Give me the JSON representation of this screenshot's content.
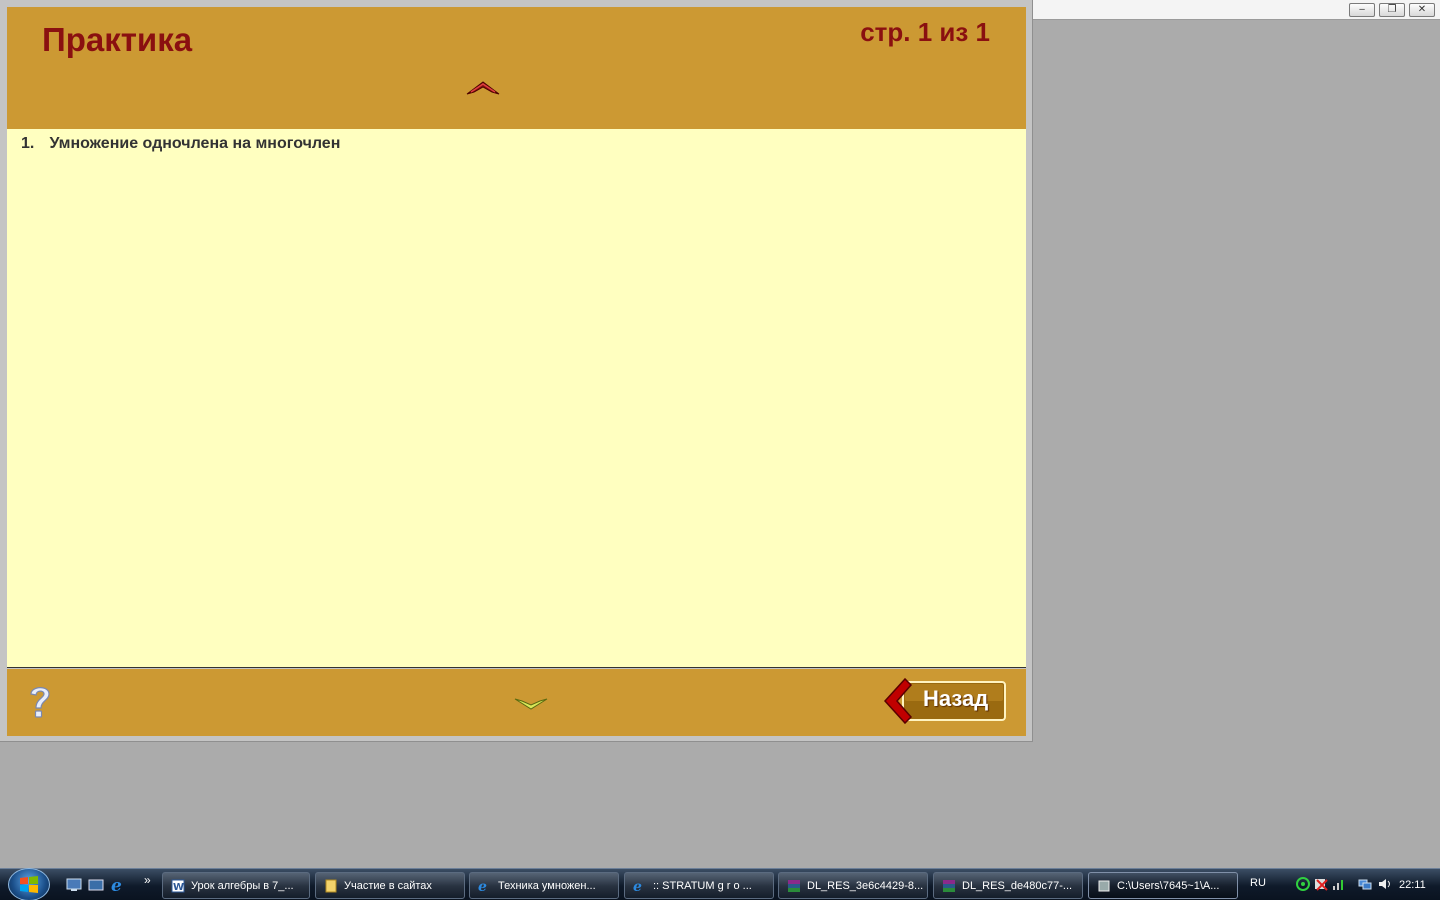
{
  "window": {
    "minimize": "‒",
    "restore": "❐",
    "close": "✕"
  },
  "header": {
    "title": "Практика",
    "page_info": "стр. 1 из 1",
    "scroll_up_icon": "chevron-up-icon"
  },
  "content": {
    "items": [
      {
        "num": "1.",
        "text": "Умножение одночлена на многочлен"
      }
    ]
  },
  "footer": {
    "help_icon": "question-mark-icon",
    "scroll_down_icon": "chevron-down-icon",
    "back_label": "Назад"
  },
  "taskbar": {
    "quicklaunch_more": "»",
    "tasks": [
      {
        "label": "Урок алгебры в 7_...",
        "icon": "word-document-icon"
      },
      {
        "label": "Участие в сайтах",
        "icon": "folder-icon"
      },
      {
        "label": "Техника умножен...",
        "icon": "internet-explorer-icon"
      },
      {
        "label": ":: STRATUM g r o ...",
        "icon": "internet-explorer-icon"
      },
      {
        "label": "DL_RES_3e6c4429-8...",
        "icon": "archive-icon"
      },
      {
        "label": "DL_RES_de480c77-...",
        "icon": "archive-icon"
      },
      {
        "label": "C:\\Users\\7645~1\\A...",
        "icon": "application-icon"
      }
    ],
    "language": "RU",
    "clock": "22:11"
  },
  "colors": {
    "panel": "#cc9933",
    "content_bg": "#ffffc0",
    "title_text": "#8a1010",
    "desktop": "#ababab"
  }
}
